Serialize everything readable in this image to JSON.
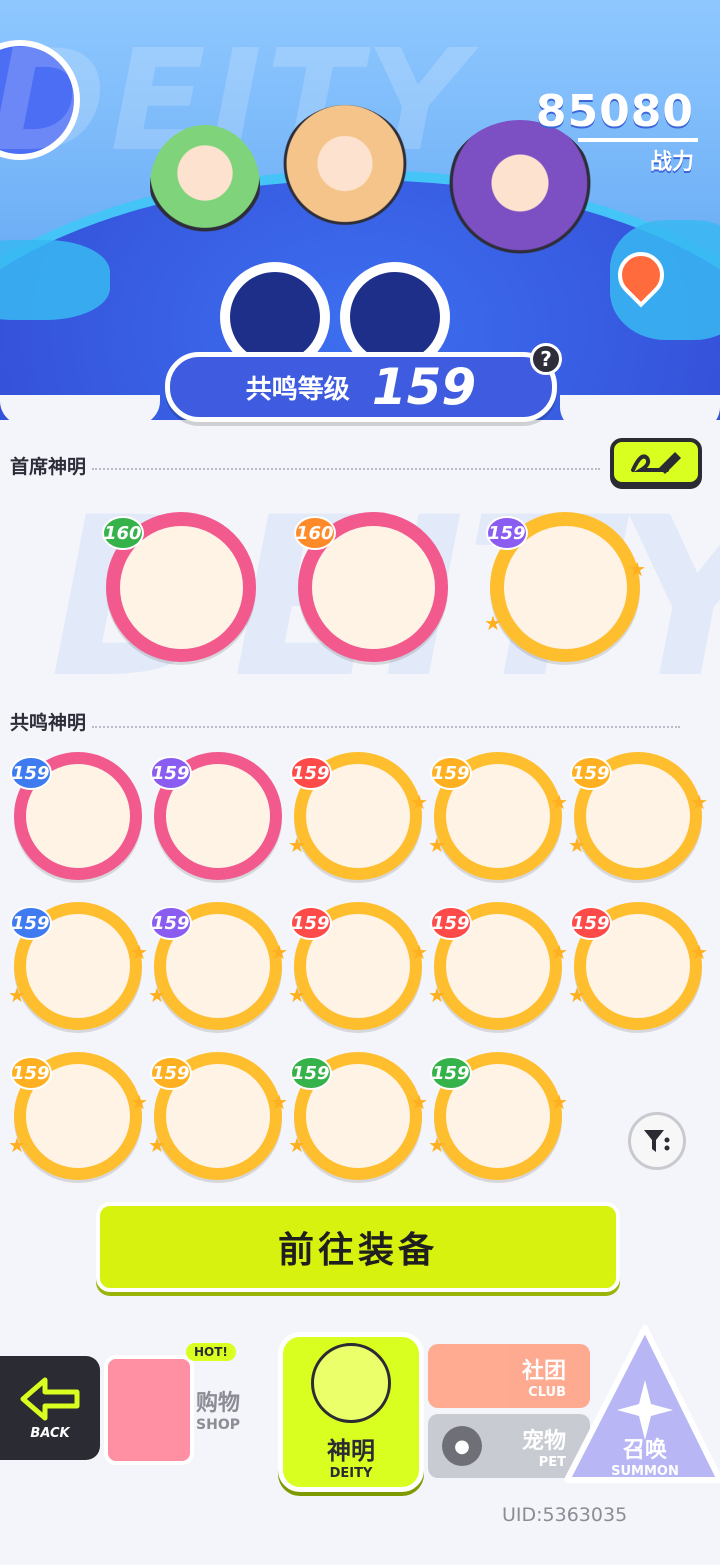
{
  "header": {
    "bg_word": "DEITY",
    "power_value": "85080",
    "power_label": "战力",
    "resonance_label": "共鸣等级",
    "resonance_level": "159",
    "help_icon": "question-icon"
  },
  "sections": {
    "chief_title": "首席神明",
    "resonance_title": "共鸣神明"
  },
  "chief_deities": [
    {
      "level": "160",
      "frame": "pink",
      "tag_color": "#36b24a"
    },
    {
      "level": "160",
      "frame": "pink",
      "tag_color": "#ff8a2a"
    },
    {
      "level": "159",
      "frame": "gold",
      "tag_color": "#8a5cf0"
    }
  ],
  "resonance_deities": [
    {
      "level": "159",
      "frame": "pink",
      "tag_color": "#3f7bf0"
    },
    {
      "level": "159",
      "frame": "pink",
      "tag_color": "#8a5cf0"
    },
    {
      "level": "159",
      "frame": "gold",
      "tag_color": "#ff4a4a"
    },
    {
      "level": "159",
      "frame": "gold",
      "tag_color": "#ffb020"
    },
    {
      "level": "159",
      "frame": "gold",
      "tag_color": "#ffb020"
    },
    {
      "level": "159",
      "frame": "gold",
      "tag_color": "#3f7bf0"
    },
    {
      "level": "159",
      "frame": "gold",
      "tag_color": "#8a5cf0"
    },
    {
      "level": "159",
      "frame": "gold",
      "tag_color": "#ff4a4a"
    },
    {
      "level": "159",
      "frame": "gold",
      "tag_color": "#ff4a4a"
    },
    {
      "level": "159",
      "frame": "gold",
      "tag_color": "#ff4a4a"
    },
    {
      "level": "159",
      "frame": "gold",
      "tag_color": "#ffb020"
    },
    {
      "level": "159",
      "frame": "gold",
      "tag_color": "#ffb020"
    },
    {
      "level": "159",
      "frame": "gold",
      "tag_color": "#36b24a"
    },
    {
      "level": "159",
      "frame": "gold",
      "tag_color": "#36b24a"
    }
  ],
  "actions": {
    "equip_label": "前往装备",
    "edit_icon": "pencil-icon",
    "filter_icon": "filter-icon"
  },
  "nav": {
    "back_label": "BACK",
    "shop_cn": "购物",
    "shop_en": "SHOP",
    "shop_hot": "HOT!",
    "deity_cn": "神明",
    "deity_en": "DEITY",
    "club_cn": "社团",
    "club_en": "CLUB",
    "pet_cn": "宠物",
    "pet_en": "PET",
    "summon_cn": "召唤",
    "summon_en": "SUMMON"
  },
  "footer": {
    "uid": "UID:5363035"
  },
  "colors": {
    "pink_frame": "#f25a8e",
    "gold_frame": "#ffbe2e",
    "accent_lime": "#d8f20f",
    "banner_blue": "#3f5ce0"
  }
}
